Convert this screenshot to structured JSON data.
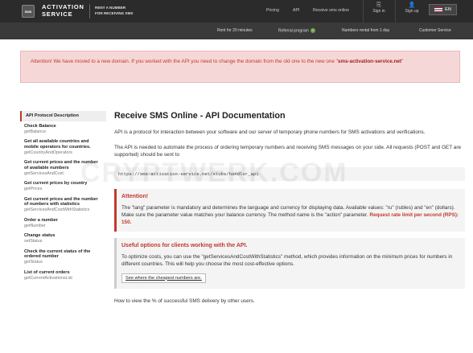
{
  "header": {
    "logo_mark": "SMS",
    "logo_line1": "ACTIVATION",
    "logo_line2": "SERVICE",
    "tagline_line1": "RENT A NUMBER",
    "tagline_line2": "FOR RECEIVING SMS",
    "nav": [
      "Pricing",
      "API",
      "Receive sms online"
    ],
    "sign_in": "Sign in",
    "sign_up": "Sign up",
    "lang": "EN"
  },
  "subnav": {
    "rent20": "Rent for 20 minutes",
    "referral": "Referral program",
    "rental1day": "Numbers rental from 1 day",
    "support": "Customer Service"
  },
  "alert": {
    "text": "Attention! We have moved to a new domain. If you worked with the API you need to change the domain from the old one to the new one \"",
    "domain": "sms-activation-service.net",
    "end": "\""
  },
  "sidebar": [
    {
      "title": "API Protocol Description",
      "sub": ""
    },
    {
      "title": "Check Balance",
      "sub": "getBalance"
    },
    {
      "title": "Get all available countries and mobile operators for countries.",
      "sub": "getCountryAndOperators"
    },
    {
      "title": "Get current prices and the number of available numbers",
      "sub": "getServicesAndCost"
    },
    {
      "title": "Get current prices by country",
      "sub": "getPrices"
    },
    {
      "title": "Get current prices and the number of numbers with statistics",
      "sub": "getServicesAndCostWithStatistics"
    },
    {
      "title": "Order a number",
      "sub": "getNumber"
    },
    {
      "title": "Change status",
      "sub": "setStatus"
    },
    {
      "title": "Check the current status of the ordered number",
      "sub": "getStatus"
    },
    {
      "title": "List of current orders",
      "sub": "getCurrentActivationsList"
    }
  ],
  "main": {
    "title": "Receive SMS Online - API Documentation",
    "p1": "API is a protocol for interaction between your software and our server of temporary phone numbers for SMS activations and verifications.",
    "p2": "The API is needed to automate the process of ordering temporary numbers and receiving SMS messages on your side. All requests (POST and GET are supported) should be sent to",
    "endpoint": "https://sms-activation-service.net/stubs/handler_api",
    "warn_title": "Attention!",
    "warn_text": "The \"lang\" parameter is mandatory and determines the language and currency for displaying data. Available values: \"ru\" (rubles) and \"en\" (dollars). Make sure the parameter value matches your balance currency. The method name is the \"action\" parameter.",
    "warn_rate": "Request rate limit per second (RPS): 150.",
    "useful_title": "Useful options for clients working with the API.",
    "useful_text": "To optimize costs, you can use the \"getServicesAndCostWithStatistics\" method, which provides information on the minimum prices for numbers in different countries. This will help you choose the most cost-effective options.",
    "useful_link": "See where the cheapest numbers are.",
    "tail": "How to view the % of successful SMS delivery by other users."
  },
  "watermark": "CRYPTWERK.COM"
}
